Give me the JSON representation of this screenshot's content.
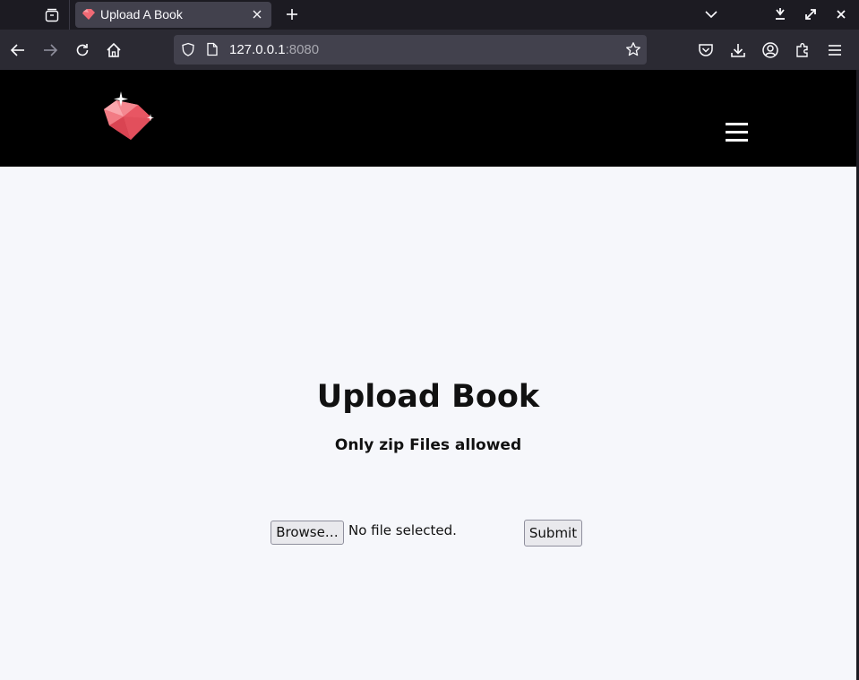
{
  "browser": {
    "tab": {
      "title": "Upload A Book"
    },
    "url": {
      "host": "127.0.0.1",
      "port": ":8080"
    }
  },
  "page": {
    "heading": "Upload Book",
    "subheading": "Only zip Files allowed",
    "form": {
      "browse_label": "Browse…",
      "file_status": "No file selected.",
      "submit_label": "Submit"
    }
  },
  "colors": {
    "header_bg": "#000000",
    "page_bg": "#f6f7fb",
    "logo": "#f06a75"
  }
}
